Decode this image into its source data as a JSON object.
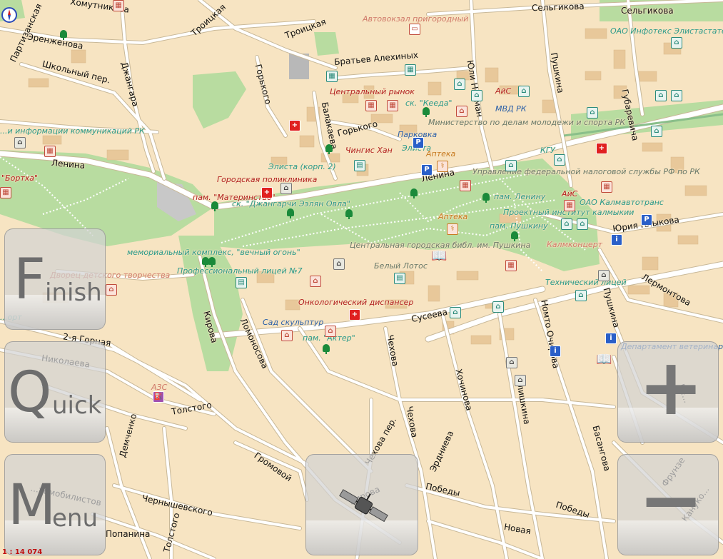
{
  "app": {
    "scale_text": "1 : 14 074"
  },
  "buttons": {
    "finish": {
      "initial": "F",
      "rest": "inish"
    },
    "quick": {
      "initial": "Q",
      "rest": "uick"
    },
    "menu": {
      "initial": "M",
      "rest": "enu"
    },
    "zoom_in": "+",
    "zoom_out": "−"
  },
  "streets": {
    "khomutnikova": "Хомутникова",
    "partizanskaya": "Партизанская",
    "erenzhenova": "Эренженова",
    "shkolny": "Школьный пер.",
    "dzhangara": "Джангара",
    "troitskaya1": "Троицкая",
    "troitskaya2": "Троицкая",
    "gorkogo1": "Горького",
    "gorkogo2": "Горького",
    "bratev": "Братьев Алехиных",
    "yuli": "Юли Нейман",
    "pushkina1": "Пушкина",
    "pushkina2": "Пушкина",
    "selgikova1": "Сельгикова",
    "selgikova2": "Сельгикова",
    "gubarevicha": "Губаревича",
    "balakaeva": "Балакаева",
    "lenina1": "Ленина",
    "lenina2": "Ленина",
    "yuriya": "Юрия Клыкова",
    "lermontova": "Лермонтова",
    "kirova1": "Кирова",
    "kirova2": "Кирова",
    "lomonosova": "Ломоносова",
    "chekhova1": "Чехова",
    "chekhova2": "Чехова",
    "chekhova_per": "Чехова пер.",
    "suseeva": "Сусеева",
    "nomto": "Номто Очирова",
    "khochinova": "Хочинова",
    "ilishkina": "Илишкина",
    "basangova": "Басангова",
    "erdnieva": "Эрдниева",
    "pobedy1": "Победы",
    "pobedy2": "Победы",
    "novaya": "Новая",
    "frunze": "Фрунзе",
    "kanukova": "Кануко...",
    "bembeeva": "Бе...",
    "vtoraya_gornaya": "2-я Горная",
    "nikolaeva": "Николаева",
    "tolstogo1": "Толстого",
    "tolstogo2": "Толстого",
    "demchenko": "Демченко",
    "gromovoy": "Громовой",
    "chernyshevskogo": "Чернышевского",
    "popanina": "Попанина",
    "avtomobilistov": "...томобилистов"
  },
  "pois": {
    "avtovokzal": "Автовокзал пригородный",
    "infoteks": "ОАО Инфотекс Элистастатет...",
    "tsentr_rynok": "Центральный рынок",
    "keeda": "ск. \"Кееда\"",
    "ais1": "АйС",
    "mvd": "МВД РК",
    "ministry": "Министерство по делам молодежи и спорта РК",
    "parkovka": "Парковка",
    "chingis": "Чингис Хан",
    "elista1": "Элиста",
    "apteka1": "Аптека",
    "kgu": "КГУ",
    "elista2": "Элиста (корп. 2)",
    "poliklinika": "Городская поликлиника",
    "nalog": "Управление федеральной налоговой службы РФ по РК",
    "materinstvo": "пам. \"Материнство\"",
    "dzhangarchi": "ск. \"Джангарчи Ээлян Овла\"",
    "pam_leninu": "пам. Ленину",
    "ais2": "АйС",
    "kalmavtotrans": "ОАО Калмавтотранс",
    "proekt": "Проектный институт калмыкии",
    "apteka2": "Аптека",
    "pam_pushkinu": "пам. Пушкину",
    "memorial": "мемориальный комплекс, \"вечный огонь\"",
    "biblioteka": "Центральная городская библ. им. Пушкина",
    "kalmkoncert": "Калмконцерт",
    "dvorets": "Дворец детского творчества",
    "licey": "Профессиональный лицей №7",
    "lotos": "Белый Лотос",
    "tehnicheskiy": "Технический лицей",
    "informatsii": "...и информации коммуникаций РК",
    "bortkha": "\"Бортха\"",
    "onkology": "Онкологический диспансер",
    "sad": "Сад скульптур",
    "akter": "пам. \"Актер\"",
    "departament": "Департамент ветеринар...",
    "azs": "АЗС",
    "sport": "...орт"
  }
}
